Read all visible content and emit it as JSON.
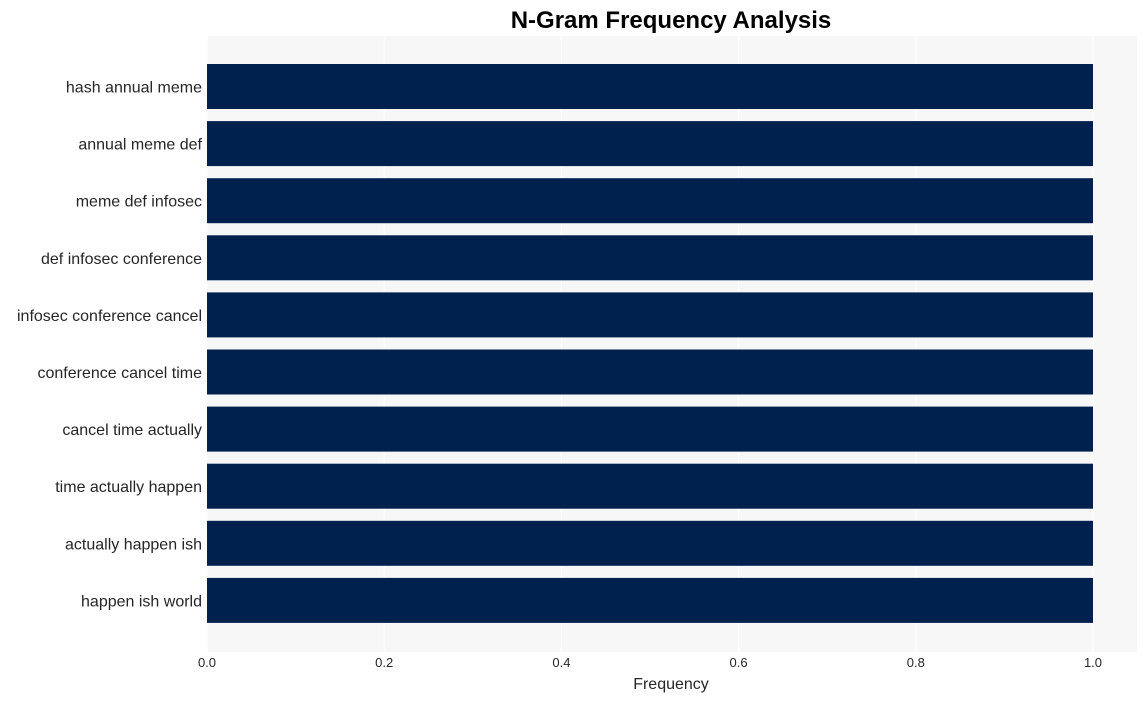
{
  "chart_data": {
    "type": "bar",
    "orientation": "horizontal",
    "title": "N-Gram Frequency Analysis",
    "xlabel": "Frequency",
    "ylabel": "",
    "categories": [
      "hash annual meme",
      "annual meme def",
      "meme def infosec",
      "def infosec conference",
      "infosec conference cancel",
      "conference cancel time",
      "cancel time actually",
      "time actually happen",
      "actually happen ish",
      "happen ish world"
    ],
    "values": [
      1,
      1,
      1,
      1,
      1,
      1,
      1,
      1,
      1,
      1
    ],
    "xlim": [
      0,
      1.05
    ],
    "xticks": [
      "0.0",
      "0.2",
      "0.4",
      "0.6",
      "0.8",
      "1.0"
    ],
    "grid": true,
    "legend": "none",
    "colors": {
      "bar": "#00204e",
      "plot_bg": "#f7f7f7",
      "grid": "#ffffff"
    }
  }
}
